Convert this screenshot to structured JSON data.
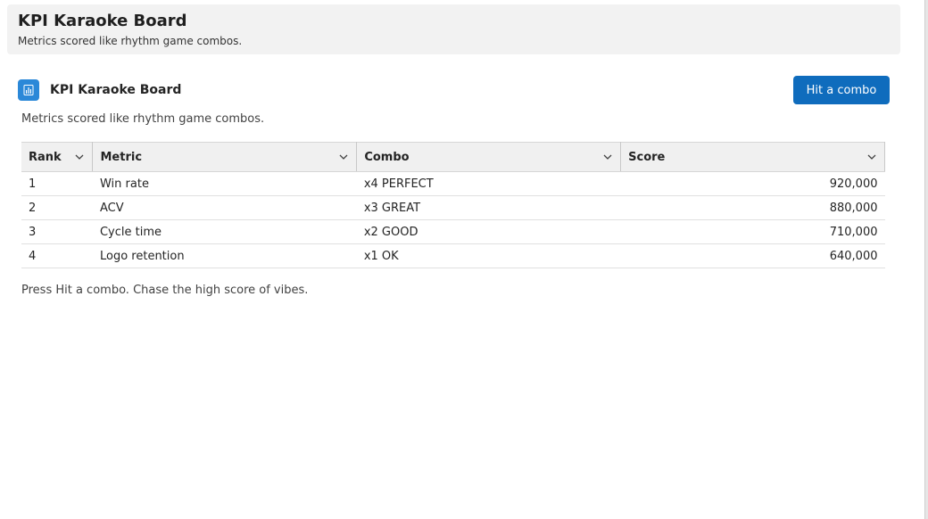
{
  "header": {
    "title": "KPI Karaoke Board",
    "subtitle": "Metrics scored like rhythm game combos."
  },
  "card": {
    "icon": "bar-chart-icon",
    "title": "KPI Karaoke Board",
    "description": "Metrics scored like rhythm game combos.",
    "button_label": "Hit a combo",
    "accent_color": "#0f6cbd"
  },
  "table": {
    "columns": [
      "Rank",
      "Metric",
      "Combo",
      "Score"
    ],
    "rows": [
      {
        "rank": "1",
        "metric": "Win rate",
        "combo": "x4 PERFECT",
        "score": "920,000"
      },
      {
        "rank": "2",
        "metric": "ACV",
        "combo": "x3 GREAT",
        "score": "880,000"
      },
      {
        "rank": "3",
        "metric": "Cycle time",
        "combo": "x2 GOOD",
        "score": "710,000"
      },
      {
        "rank": "4",
        "metric": "Logo retention",
        "combo": "x1 OK",
        "score": "640,000"
      }
    ]
  },
  "footer": {
    "note": "Press Hit a combo. Chase the high score of vibes."
  }
}
